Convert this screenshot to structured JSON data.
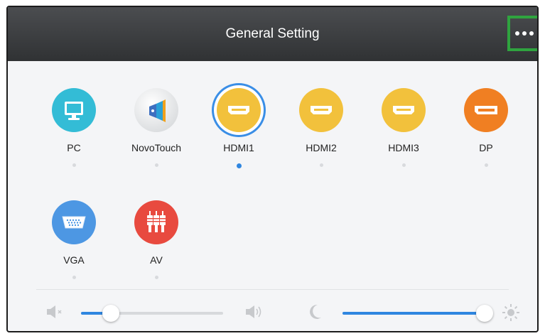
{
  "header": {
    "title": "General Setting",
    "more_icon": "more-dots-icon"
  },
  "sources": [
    {
      "label": "PC",
      "icon": "monitor-icon",
      "color": "#33bcd6"
    },
    {
      "label": "NovoTouch",
      "icon": "novotouch-icon",
      "color": "#e4e4e4"
    },
    {
      "label": "HDMI1",
      "icon": "hdmi-icon",
      "color": "#f2c13c",
      "selected": true
    },
    {
      "label": "HDMI2",
      "icon": "hdmi-icon",
      "color": "#f2c13c"
    },
    {
      "label": "HDMI3",
      "icon": "hdmi-icon",
      "color": "#f2c13c"
    },
    {
      "label": "DP",
      "icon": "displayport-icon",
      "color": "#f07f22"
    },
    {
      "label": "VGA",
      "icon": "vga-icon",
      "color": "#4d97e3"
    },
    {
      "label": "AV",
      "icon": "av-rca-icon",
      "color": "#e84a3f"
    }
  ],
  "volume": {
    "value_fraction": 0.21,
    "mute_icon": "volume-mute-icon",
    "max_icon": "volume-up-icon"
  },
  "brightness": {
    "value_fraction": 1.0,
    "min_icon": "moon-icon",
    "max_icon": "sun-icon"
  },
  "colors": {
    "accent": "#2f86e0",
    "header": "#3b3d40",
    "highlight": "#2fa43f"
  }
}
